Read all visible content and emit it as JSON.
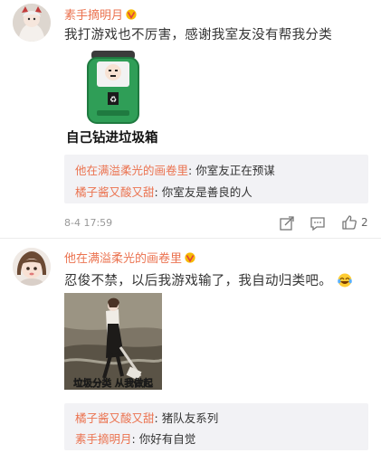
{
  "comments": [
    {
      "username": "素手摘明月",
      "text": "我打游戏也不厉害，感谢我室友没有帮我分类",
      "sticker_caption": "自己钻进垃圾箱",
      "time": "8-4 17:59",
      "likes": "2",
      "replies": [
        {
          "name": "他在满溢柔光的画卷里",
          "text": "你室友正在预谋"
        },
        {
          "name": "橘子酱又酸又甜",
          "text": "你室友是善良的人"
        }
      ]
    },
    {
      "username": "他在满溢柔光的画卷里",
      "text": "忍俊不禁，以后我游戏输了，我自动归类吧。",
      "image_caption": "垃圾分类 从我做起",
      "replies": [
        {
          "name": "橘子酱又酸又甜",
          "text": "猪队友系列"
        },
        {
          "name": "素手摘明月",
          "text": "你好有自觉"
        }
      ]
    }
  ],
  "colors": {
    "username": "#eb7350",
    "reply_bg": "#f2f2f5",
    "bin_green": "#2f9e57"
  },
  "icons": [
    "vip-badge-icon",
    "share-icon",
    "comment-icon",
    "like-icon",
    "laugh-emoji-icon"
  ]
}
